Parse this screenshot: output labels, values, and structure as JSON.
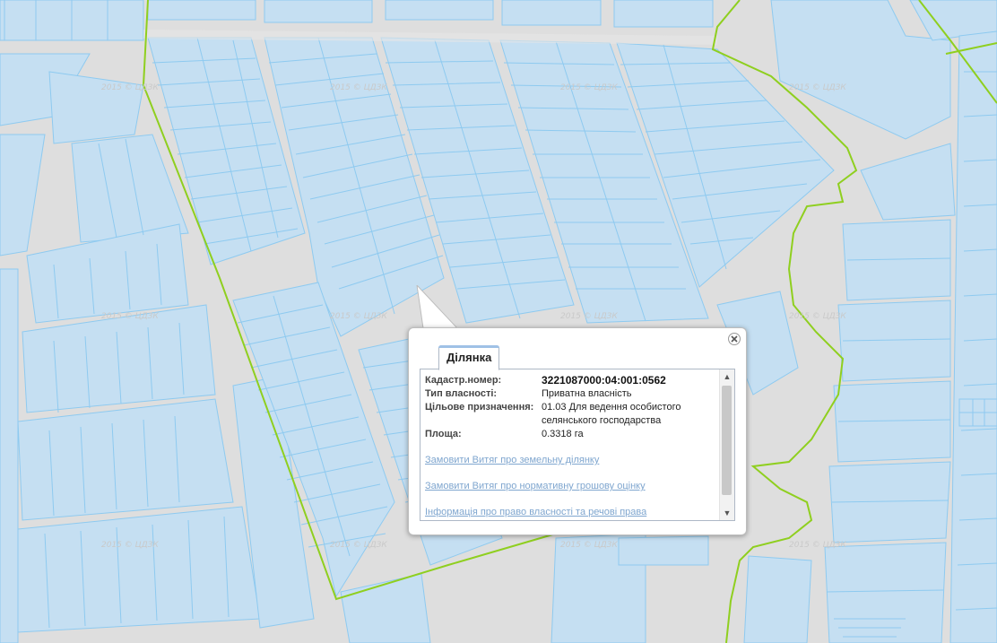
{
  "map": {
    "watermark": "2015 © ЦДЗК",
    "colors": {
      "background": "#dedede",
      "parcel_fill": "#c5dff2",
      "parcel_stroke": "#8ecaf0",
      "road": "#e9e9e9",
      "boundary_line": "#8fcf1f"
    }
  },
  "popup": {
    "tab_label": "Ділянка",
    "close_icon": "close-icon",
    "fields": [
      {
        "label": "Кадастр.номер:",
        "value": "3221087000:04:001:0562"
      },
      {
        "label": "Тип власності:",
        "value": "Приватна власність"
      },
      {
        "label": "Цільове призначення:",
        "value": "01.03 Для ведення особистого селянського господарства"
      },
      {
        "label": "Площа:",
        "value": "0.3318 га"
      }
    ],
    "links": [
      "Замовити Витяг про земельну ділянку",
      "Замовити Витяг про нормативну грошову оцінку",
      "Інформація про право власності та речові права"
    ]
  }
}
